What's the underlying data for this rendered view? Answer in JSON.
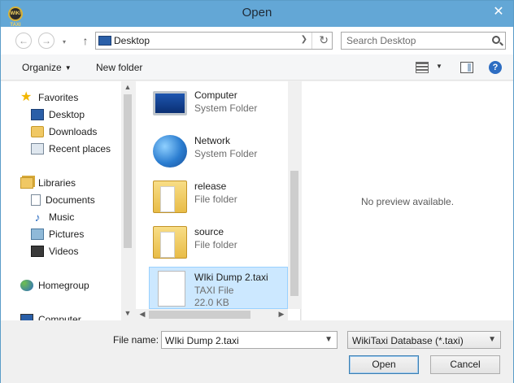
{
  "window": {
    "title": "Open",
    "app_icon_text": "WIKI TAXI"
  },
  "nav": {
    "back_icon": "arrow-left",
    "forward_icon": "arrow-right",
    "up_icon": "arrow-up",
    "address": "Desktop",
    "search_placeholder": "Search Desktop"
  },
  "toolbar": {
    "organize": "Organize",
    "new_folder": "New folder"
  },
  "sidebar": {
    "favorites": "Favorites",
    "desktop": "Desktop",
    "downloads": "Downloads",
    "recent_places": "Recent places",
    "libraries": "Libraries",
    "documents": "Documents",
    "music": "Music",
    "pictures": "Pictures",
    "videos": "Videos",
    "homegroup": "Homegroup",
    "computer": "Computer"
  },
  "files": [
    {
      "name": "Computer",
      "type": "System Folder"
    },
    {
      "name": "Network",
      "type": "System Folder"
    },
    {
      "name": "release",
      "type": "File folder"
    },
    {
      "name": "source",
      "type": "File folder"
    },
    {
      "name": "WIki Dump 2.taxi",
      "type": "TAXI File",
      "size": "22.0 KB",
      "selected": true
    }
  ],
  "preview": {
    "message": "No preview available."
  },
  "footer": {
    "file_name_label": "File name:",
    "file_name_value": "WIki Dump 2.taxi",
    "file_type": "WikiTaxi Database (*.taxi)",
    "open": "Open",
    "cancel": "Cancel"
  },
  "colors": {
    "titlebar": "#63a7d6",
    "selection": "#cce8ff",
    "selection_border": "#99d1ff"
  }
}
